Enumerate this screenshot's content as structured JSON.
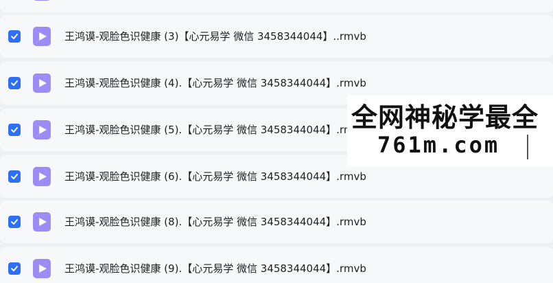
{
  "files": [
    {
      "name": "王鸿谟-观脸色识健康 (3)【心元易学 微信 3458344044】..rmvb",
      "checked": true
    },
    {
      "name": "王鸿谟-观脸色识健康 (4).【心元易学 微信 3458344044】.rmvb",
      "checked": true
    },
    {
      "name": "王鸿谟-观脸色识健康 (5).【心元易学 微信 3458344044】.rmvb",
      "checked": true
    },
    {
      "name": "王鸿谟-观脸色识健康 (6).【心元易学 微信 3458344044】.rmvb",
      "checked": true
    },
    {
      "name": "王鸿谟-观脸色识健康 (8).【心元易学 微信 3458344044】.rmvb",
      "checked": true
    },
    {
      "name": "王鸿谟-观脸色识健康 (9).【心元易学 微信 3458344044】.rmvb",
      "checked": true
    }
  ],
  "watermark": {
    "title": "全网神秘学最全",
    "subtitle": "761m.com"
  },
  "colors": {
    "checkbox": "#2f6ff5",
    "file_icon": "#9b8cf6",
    "row_bg": "#f7f8fa",
    "page_bg": "#eef0f4"
  },
  "icons": {
    "checkbox": "checkmark-icon",
    "file": "video-file-icon"
  }
}
